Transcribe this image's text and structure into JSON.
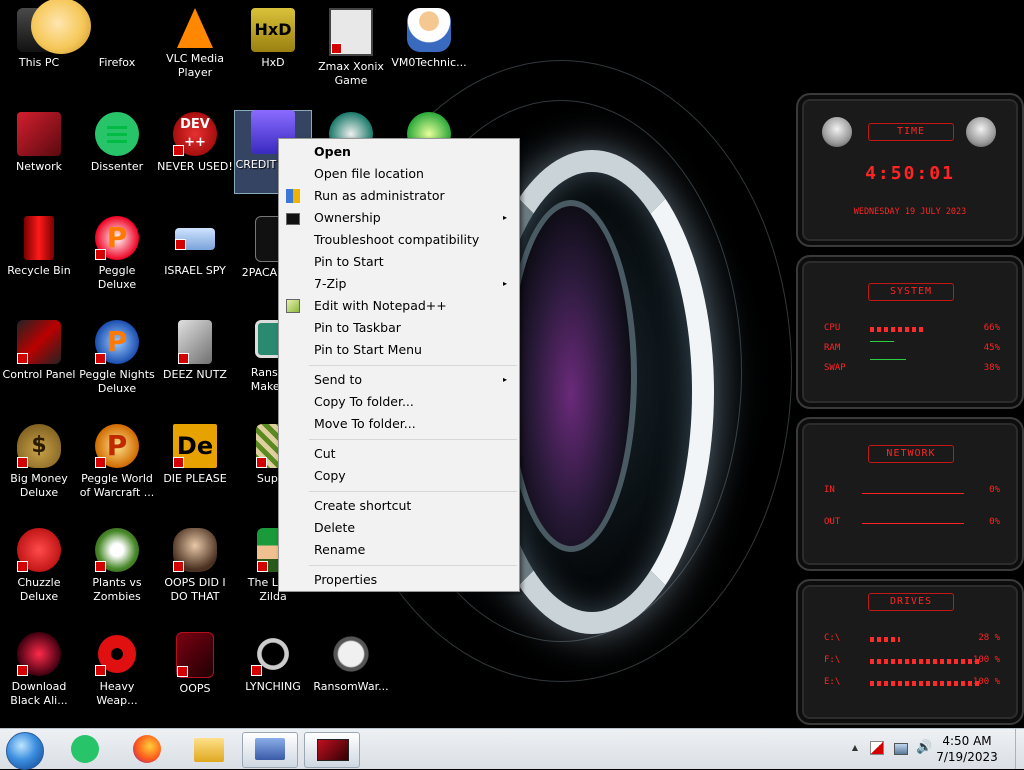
{
  "desktop": {
    "icons": [
      {
        "label": "This PC"
      },
      {
        "label": "Firefox"
      },
      {
        "label": "VLC Media Player"
      },
      {
        "label": "HxD"
      },
      {
        "label": "Zmax Xonix Game"
      },
      {
        "label": "VM0Technic..."
      },
      {
        "label": "Network"
      },
      {
        "label": "Dissenter"
      },
      {
        "label": "NEVER USED!"
      },
      {
        "label": "CREDIT CHEC"
      },
      {
        "label": "Recycle Bin"
      },
      {
        "label": "Peggle Deluxe"
      },
      {
        "label": "ISRAEL SPY"
      },
      {
        "label": "2PACAL 2.3"
      },
      {
        "label": "Control Panel"
      },
      {
        "label": "Peggle Nights Deluxe"
      },
      {
        "label": "DEEZ NUTZ"
      },
      {
        "label": "Ransom Maker B"
      },
      {
        "label": "Big Money Deluxe"
      },
      {
        "label": "Peggle World of Warcraft ..."
      },
      {
        "label": "DIE PLEASE"
      },
      {
        "label": "Super"
      },
      {
        "label": "Chuzzle Deluxe"
      },
      {
        "label": "Plants vs Zombies"
      },
      {
        "label": "OOPS DID I DO THAT"
      },
      {
        "label": "The Lege Zilda"
      },
      {
        "label": "Download Black Ali..."
      },
      {
        "label": "Heavy Weap..."
      },
      {
        "label": "OOPS"
      },
      {
        "label": "LYNCHING"
      },
      {
        "label": "RansomWar..."
      }
    ],
    "glyph_texts": {
      "hxd": "HxD",
      "dev": "DEV",
      "dev_plus": "++",
      "de": "De",
      "peggle": "P"
    }
  },
  "context_menu": {
    "items": [
      {
        "label": "Open"
      },
      {
        "label": "Open file location"
      },
      {
        "label": "Run as administrator"
      },
      {
        "label": "Ownership"
      },
      {
        "label": "Troubleshoot compatibility"
      },
      {
        "label": "Pin to Start"
      },
      {
        "label": "7-Zip"
      },
      {
        "label": "Edit with Notepad++"
      },
      {
        "label": "Pin to Taskbar"
      },
      {
        "label": "Pin to Start Menu"
      },
      {
        "label": "Send to"
      },
      {
        "label": "Copy To folder..."
      },
      {
        "label": "Move To folder..."
      },
      {
        "label": "Cut"
      },
      {
        "label": "Copy"
      },
      {
        "label": "Create shortcut"
      },
      {
        "label": "Delete"
      },
      {
        "label": "Rename"
      },
      {
        "label": "Properties"
      }
    ],
    "submenu_arrow": "▸"
  },
  "widget": {
    "time": {
      "header": "TIME",
      "clock": "4:50:01",
      "date": "WEDNESDAY 19 JULY 2023"
    },
    "system": {
      "header": "SYSTEM",
      "rows": [
        {
          "label": "CPU",
          "value": "66%",
          "percent": 66
        },
        {
          "label": "RAM",
          "value": "45%",
          "percent": 45
        },
        {
          "label": "SWAP",
          "value": "38%",
          "percent": 38
        }
      ]
    },
    "network": {
      "header": "NETWORK",
      "rows": [
        {
          "label": "IN",
          "value": "0%"
        },
        {
          "label": "OUT",
          "value": "0%"
        }
      ]
    },
    "drives": {
      "header": "DRIVES",
      "rows": [
        {
          "label": "C:\\",
          "value": "28 %",
          "percent": 28
        },
        {
          "label": "F:\\",
          "value": "100 %",
          "percent": 100
        },
        {
          "label": "E:\\",
          "value": "100 %",
          "percent": 100
        }
      ]
    }
  },
  "taskbar": {
    "clock_time": "4:50 AM",
    "clock_date": "7/19/2023",
    "tray_chevron": "▲",
    "volume_glyph": "🔊"
  },
  "colors": {
    "accent_red": "#ff2424",
    "menu_bg": "#f2f2f2",
    "taskbar_bg": "#dfe4ea"
  }
}
